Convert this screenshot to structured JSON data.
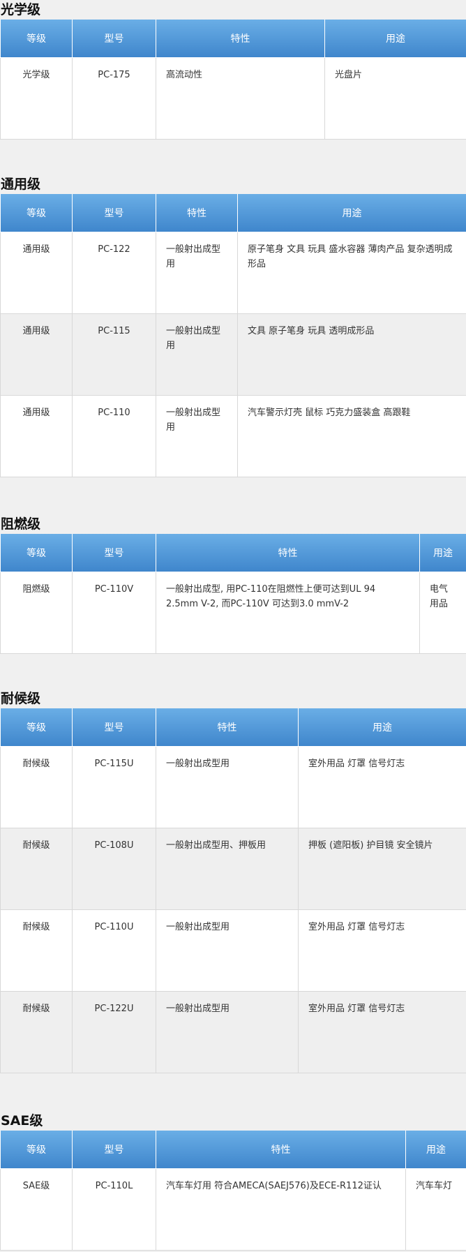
{
  "headers": {
    "grade": "等级",
    "model": "型号",
    "property": "特性",
    "use": "用途"
  },
  "sections": [
    {
      "title": "光学级",
      "rows": [
        {
          "grade": "光学级",
          "model": "PC-175",
          "property": "高流动性",
          "use": "光盘片"
        }
      ]
    },
    {
      "title": "通用级",
      "rows": [
        {
          "grade": "通用级",
          "model": "PC-122",
          "property": "一般射出成型用",
          "use": "原子笔身 文具 玩具 盛水容器 薄肉产品 复杂透明成形品"
        },
        {
          "grade": "通用级",
          "model": "PC-115",
          "property": "一般射出成型用",
          "use": "文具 原子笔身 玩具 透明成形品"
        },
        {
          "grade": "通用级",
          "model": "PC-110",
          "property": "一般射出成型用",
          "use": "汽车警示灯壳 鼠标 巧克力盛装盒 高跟鞋"
        }
      ]
    },
    {
      "title": "阻燃级",
      "rows": [
        {
          "grade": "阻燃级",
          "model": "PC-110V",
          "property": "一般射出成型, 用PC-110在阻燃性上便可达到UL 94 2.5mm V-2, 而PC-110V 可达到3.0 mmV-2",
          "use": "电气用品"
        }
      ]
    },
    {
      "title": "耐候级",
      "rows": [
        {
          "grade": "耐候级",
          "model": "PC-115U",
          "property": "一般射出成型用",
          "use": "室外用品 灯罩 信号灯志"
        },
        {
          "grade": "耐候级",
          "model": "PC-108U",
          "property": "一般射出成型用、押板用",
          "use": "押板 (遮阳板) 护目镜 安全镜片"
        },
        {
          "grade": "耐候级",
          "model": "PC-110U",
          "property": "一般射出成型用",
          "use": "室外用品 灯罩 信号灯志"
        },
        {
          "grade": "耐候级",
          "model": "PC-122U",
          "property": "一般射出成型用",
          "use": "室外用品 灯罩 信号灯志"
        }
      ]
    },
    {
      "title": "SAE级",
      "rows": [
        {
          "grade": "SAE级",
          "model": "PC-110L",
          "property": "汽车车灯用 符合AMECA(SAEJ576)及ECE-R112证认",
          "use": "汽车车灯"
        }
      ]
    }
  ]
}
